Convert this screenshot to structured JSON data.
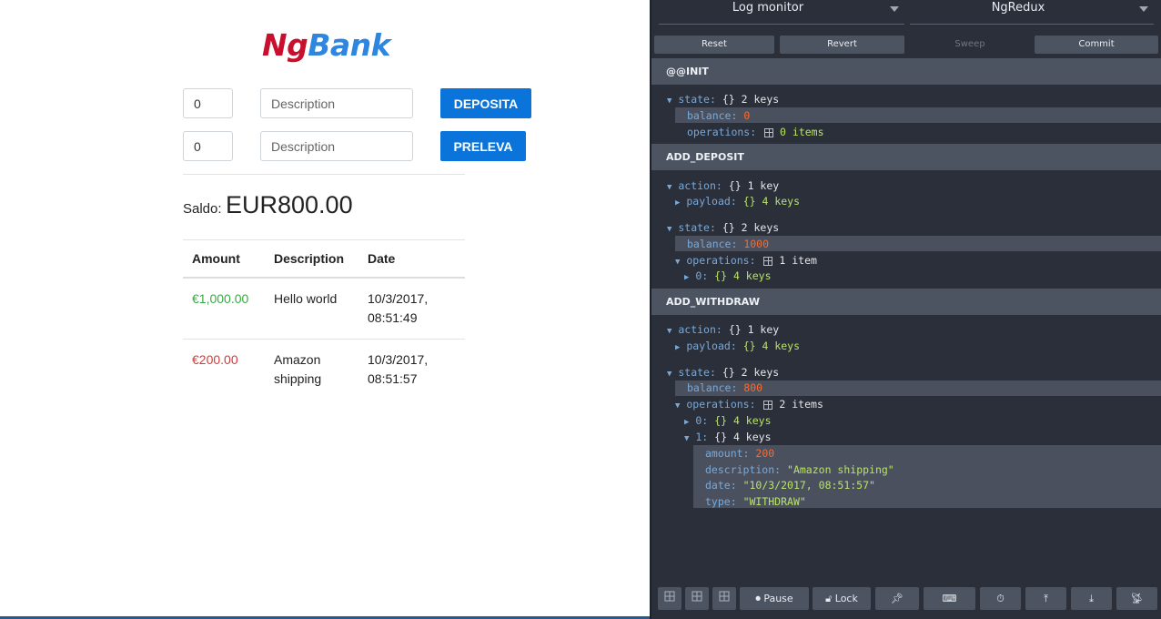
{
  "app": {
    "logo_ng": "Ng",
    "logo_bank": "Bank",
    "deposit": {
      "amount_value": "0",
      "description_placeholder": "Description",
      "button_label": "DEPOSITA"
    },
    "withdraw": {
      "amount_value": "0",
      "description_placeholder": "Description",
      "button_label": "PRELEVA"
    },
    "balance_label": "Saldo:",
    "balance_value": "EUR800.00",
    "table": {
      "headers": [
        "Amount",
        "Description",
        "Date"
      ],
      "rows": [
        {
          "amount": "€1,000.00",
          "description": "Hello world",
          "date_line1": "10/3/2017,",
          "date_line2": "08:51:49",
          "kind": "deposit"
        },
        {
          "amount": "€200.00",
          "description_line1": "Amazon",
          "description_line2": "shipping",
          "date_line1": "10/3/2017,",
          "date_line2": "08:51:57",
          "kind": "withdraw"
        }
      ]
    },
    "colors": {
      "logo_ng": "#c8102e",
      "logo_bank": "#2e86de",
      "button": "#0a74da",
      "positive": "#3aa845",
      "negative": "#d03b3b"
    }
  },
  "devtools": {
    "monitor_select": "Log monitor",
    "store_select": "NgRedux",
    "toolbar": {
      "reset": "Reset",
      "revert": "Revert",
      "sweep": "Sweep",
      "commit": "Commit"
    },
    "actions": {
      "init": {
        "title": "@@INIT",
        "state_key": "state:",
        "state_brace": "{}",
        "state_count": "2 keys",
        "balance_key": "balance:",
        "balance_val": "0",
        "operations_key": "operations:",
        "operations_count": "0 items"
      },
      "deposit": {
        "title": "ADD_DEPOSIT",
        "action_key": "action:",
        "action_brace": "{}",
        "action_count": "1 key",
        "payload_key": "payload:",
        "payload_brace": "{}",
        "payload_count": "4 keys",
        "state_key": "state:",
        "state_brace": "{}",
        "state_count": "2 keys",
        "balance_key": "balance:",
        "balance_val": "1000",
        "operations_key": "operations:",
        "operations_count": "1 item",
        "op0_key": "0:",
        "op0_brace": "{}",
        "op0_count": "4 keys"
      },
      "withdraw": {
        "title": "ADD_WITHDRAW",
        "action_key": "action:",
        "action_brace": "{}",
        "action_count": "1 key",
        "payload_key": "payload:",
        "payload_brace": "{}",
        "payload_count": "4 keys",
        "state_key": "state:",
        "state_brace": "{}",
        "state_count": "2 keys",
        "balance_key": "balance:",
        "balance_val": "800",
        "operations_key": "operations:",
        "operations_count": "2 items",
        "op0_key": "0:",
        "op0_brace": "{}",
        "op0_count": "4 keys",
        "op1_key": "1:",
        "op1_brace": "{}",
        "op1_count": "4 keys",
        "amount_key": "amount:",
        "amount_val": "200",
        "description_key": "description:",
        "description_val": "\"Amazon shipping\"",
        "date_key": "date:",
        "date_val": "\"10/3/2017, 08:51:57\"",
        "type_key": "type:",
        "type_val": "\"WITHDRAW\""
      }
    },
    "footer": {
      "pause": "Pause",
      "lock": "Lock"
    },
    "colors": {
      "background": "#2a2f3a",
      "header": "#4d5461",
      "key": "#7aa9d8",
      "number": "#fb6a2c",
      "string": "#b9e36a"
    }
  }
}
